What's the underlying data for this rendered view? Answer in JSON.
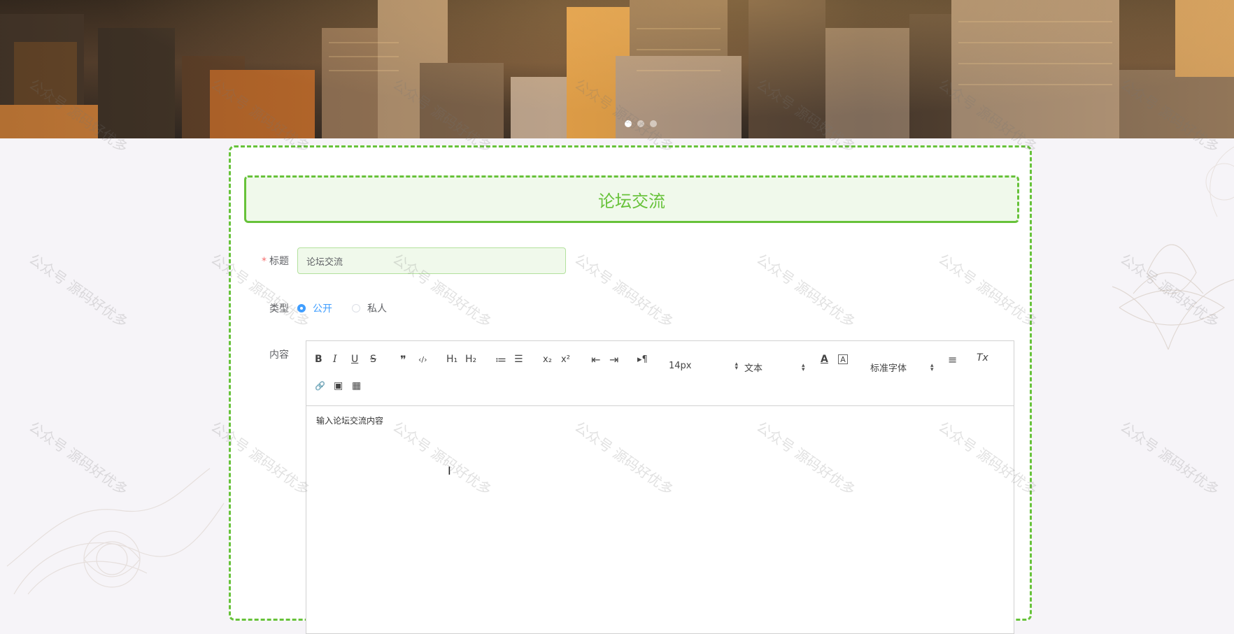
{
  "banner": {
    "slide_count": 3,
    "active_slide": 0
  },
  "watermark": {
    "text": "公众号 源码好优多"
  },
  "form": {
    "heading": "论坛交流",
    "title_field": {
      "required_mark": "*",
      "label": "标题",
      "value": "论坛交流"
    },
    "type_field": {
      "label": "类型",
      "options": [
        {
          "label": "公开",
          "checked": true
        },
        {
          "label": "私人",
          "checked": false
        }
      ]
    },
    "content_field": {
      "label": "内容",
      "placeholder": "输入论坛交流内容",
      "toolbar": {
        "bold": "B",
        "italic": "I",
        "underline": "U",
        "strike": "S",
        "blockquote": "❞",
        "code": "‹/›",
        "h1": "H₁",
        "h2": "H₂",
        "ordered_list": "≔",
        "bullet_list": "☰",
        "subscript": "x₂",
        "superscript": "x²",
        "outdent": "⇤",
        "indent": "⇥",
        "direction": "▸¶",
        "size_picker": "14px",
        "header_picker": "文本",
        "color": "A",
        "background": "A",
        "font_picker": "标准字体",
        "align": "≡",
        "clean": "Tx",
        "link": "🔗",
        "image": "▣",
        "video": "▦"
      }
    }
  },
  "colors": {
    "accent_green": "#67c23a",
    "radio_blue": "#409eff",
    "required_red": "#f56c6c"
  }
}
